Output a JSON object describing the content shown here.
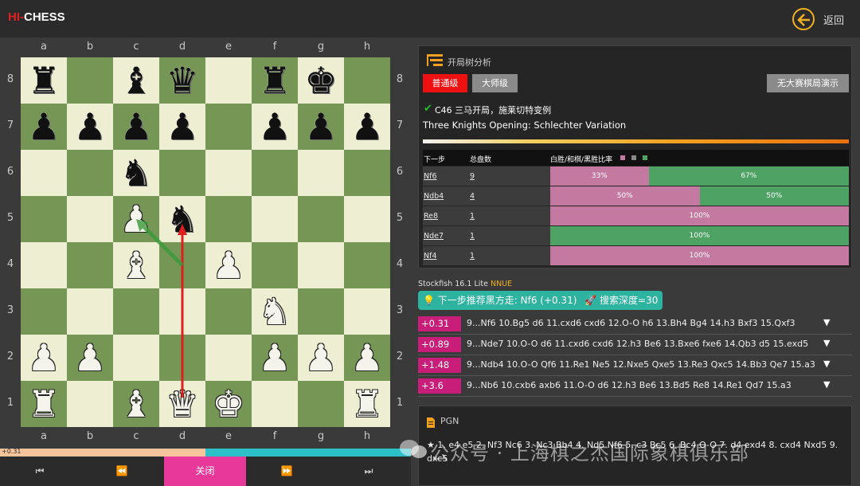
{
  "header": {
    "logo_hi": "HI",
    "logo_chess": "CHESS",
    "back_label": "返回"
  },
  "board": {
    "files": [
      "a",
      "b",
      "c",
      "d",
      "e",
      "f",
      "g",
      "h"
    ],
    "ranks": [
      "8",
      "7",
      "6",
      "5",
      "4",
      "3",
      "2",
      "1"
    ],
    "pieces": [
      {
        "sq": "a8",
        "p": "r"
      },
      {
        "sq": "c8",
        "p": "b"
      },
      {
        "sq": "d8",
        "p": "q"
      },
      {
        "sq": "f8",
        "p": "r"
      },
      {
        "sq": "g8",
        "p": "k"
      },
      {
        "sq": "a7",
        "p": "p"
      },
      {
        "sq": "b7",
        "p": "p"
      },
      {
        "sq": "c7",
        "p": "p"
      },
      {
        "sq": "d7",
        "p": "p"
      },
      {
        "sq": "f7",
        "p": "p"
      },
      {
        "sq": "g7",
        "p": "p"
      },
      {
        "sq": "h7",
        "p": "p"
      },
      {
        "sq": "c6",
        "p": "n"
      },
      {
        "sq": "c5",
        "p": "P"
      },
      {
        "sq": "d5",
        "p": "n"
      },
      {
        "sq": "c4",
        "p": "B"
      },
      {
        "sq": "e4",
        "p": "P"
      },
      {
        "sq": "f3",
        "p": "N"
      },
      {
        "sq": "a2",
        "p": "P"
      },
      {
        "sq": "b2",
        "p": "P"
      },
      {
        "sq": "f2",
        "p": "P"
      },
      {
        "sq": "g2",
        "p": "P"
      },
      {
        "sq": "h2",
        "p": "P"
      },
      {
        "sq": "a1",
        "p": "R"
      },
      {
        "sq": "c1",
        "p": "B"
      },
      {
        "sq": "d1",
        "p": "Q"
      },
      {
        "sq": "e1",
        "p": "K"
      },
      {
        "sq": "h1",
        "p": "R"
      }
    ],
    "arrows": [
      {
        "from": "d1",
        "to": "d5",
        "color": "#dd1f1f"
      },
      {
        "from": "d4",
        "to": "c5",
        "color": "#3a9a3a"
      }
    ]
  },
  "eval_bar": {
    "text": "+0.31",
    "white_fraction": 0.5
  },
  "controls": {
    "first": "⏮",
    "prev": "⏪",
    "close": "关闭",
    "next": "⏩",
    "last": "⏭"
  },
  "opening": {
    "title": "开局树分析",
    "level_normal": "普通级",
    "level_master": "大师级",
    "demo_button": "无大赛棋局演示",
    "code": "C46 三马开局，施莱切特变例",
    "english": "Three Knights Opening: Schlechter Variation",
    "col_move": "下一步",
    "col_games": "总盘数",
    "col_ratio": "白胜/和棋/黑胜比率",
    "colors": {
      "white_win": "#c47aa0",
      "draw": "#888888",
      "black_win": "#4da264"
    },
    "rows": [
      {
        "move": "Nf6",
        "games": "9",
        "white": 33,
        "black": 67,
        "white_label": "33%",
        "black_label": "67%"
      },
      {
        "move": "Ndb4",
        "games": "4",
        "white": 50,
        "black": 50,
        "white_label": "50%",
        "black_label": "50%"
      },
      {
        "move": "Re8",
        "games": "1",
        "white": 100,
        "black": 0,
        "white_label": "100%",
        "black_label": ""
      },
      {
        "move": "Nde7",
        "games": "1",
        "white": 0,
        "black": 100,
        "white_label": "",
        "black_label": "100%"
      },
      {
        "move": "Nf4",
        "games": "1",
        "white": 100,
        "black": 0,
        "white_label": "100%",
        "black_label": ""
      }
    ]
  },
  "engine": {
    "name": "Stockfish 16.1 Lite",
    "nnue": "NNUE",
    "recommend": "下一步推荐黑方走: Nf6 (+0.31)",
    "depth": "搜索深度=30",
    "lines": [
      {
        "score": "+0.31",
        "pv": "9...Nf6 10.Bg5 d6 11.cxd6 cxd6 12.O-O h6 13.Bh4 Bg4 14.h3 Bxf3 15.Qxf3"
      },
      {
        "score": "+0.89",
        "pv": "9...Nde7 10.O-O d6 11.cxd6 cxd6 12.h3 Be6 13.Bxe6 fxe6 14.Qb3 d5 15.exd5"
      },
      {
        "score": "+1.48",
        "pv": "9...Ndb4 10.O-O Qf6 11.Re1 Ne5 12.Nxe5 Qxe5 13.Re3 Qxc5 14.Bb3 Qe7 15.a3"
      },
      {
        "score": "+3.6",
        "pv": "9...Nb6 10.cxb6 axb6 11.O-O d6 12.h3 Be6 13.Bd5 Re8 14.Re1 Qd7 15.a3"
      }
    ]
  },
  "pgn": {
    "title": "PGN",
    "text": "★ 1. e4 e5 2. Nf3 Nc6 3. Nc3 Bb4 4. Nd5 Nf6 5. c3 Bc5 6. Bc4 O-O 7. d4 exd4 8. cxd4 Nxd5 9. dxc5"
  },
  "watermark": "公众号 · 上海棋之杰国际象棋俱乐部"
}
